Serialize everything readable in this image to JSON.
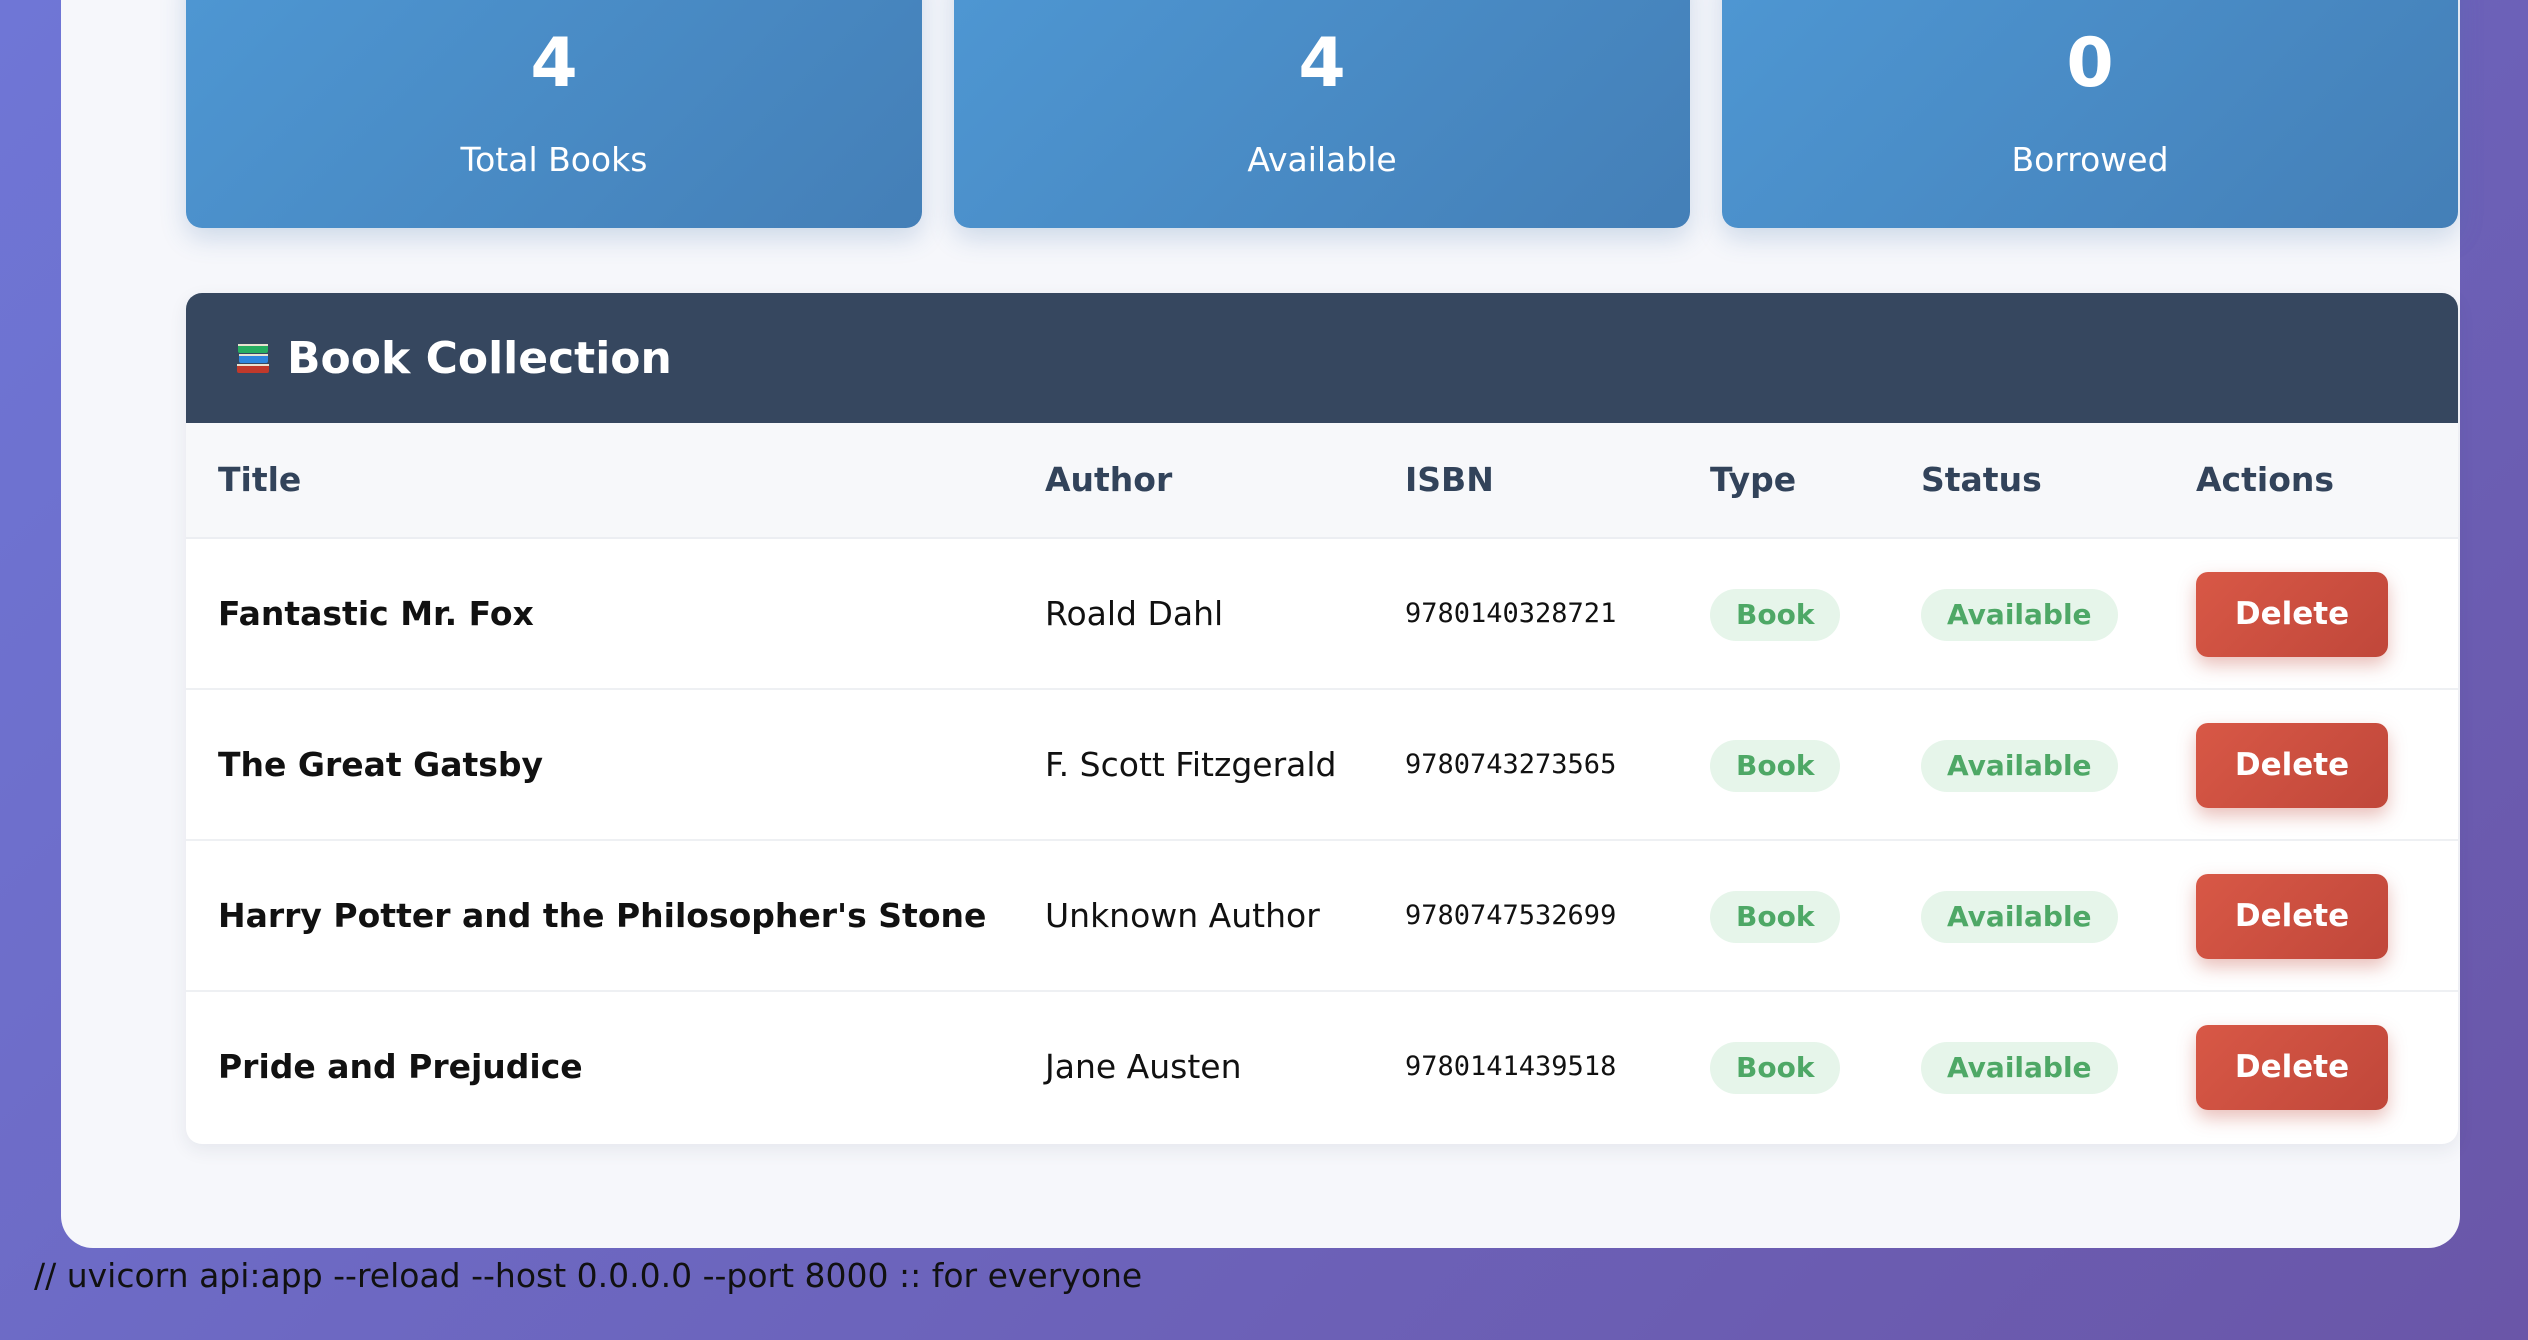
{
  "stats": [
    {
      "value": "4",
      "label": "Total Books"
    },
    {
      "value": "4",
      "label": "Available"
    },
    {
      "value": "0",
      "label": "Borrowed"
    }
  ],
  "collection": {
    "icon": "books-icon",
    "title": "Book Collection"
  },
  "table": {
    "headers": [
      "Title",
      "Author",
      "ISBN",
      "Type",
      "Status",
      "Actions"
    ],
    "rows": [
      {
        "title": "Fantastic Mr. Fox",
        "author": "Roald Dahl",
        "isbn": "9780140328721",
        "type": "Book",
        "status": "Available",
        "action": "Delete"
      },
      {
        "title": "The Great Gatsby",
        "author": "F. Scott Fitzgerald",
        "isbn": "9780743273565",
        "type": "Book",
        "status": "Available",
        "action": "Delete"
      },
      {
        "title": "Harry Potter and the Philosopher's Stone",
        "author": "Unknown Author",
        "isbn": "9780747532699",
        "type": "Book",
        "status": "Available",
        "action": "Delete"
      },
      {
        "title": "Pride and Prejudice",
        "author": "Jane Austen",
        "isbn": "9780141439518",
        "type": "Book",
        "status": "Available",
        "action": "Delete"
      }
    ]
  },
  "footer": {
    "note": "// uvicorn api:app --reload --host 0.0.0.0 --port 8000 :: for everyone"
  },
  "colors": {
    "stat_card": "#4a8ac7",
    "panel_header": "#36475f",
    "badge_bg": "#e6f5ea",
    "badge_text": "#4ea866",
    "delete_button": "#cf5141",
    "page_gradient_start": "#6f76d6",
    "page_gradient_end": "#6a56a8"
  }
}
